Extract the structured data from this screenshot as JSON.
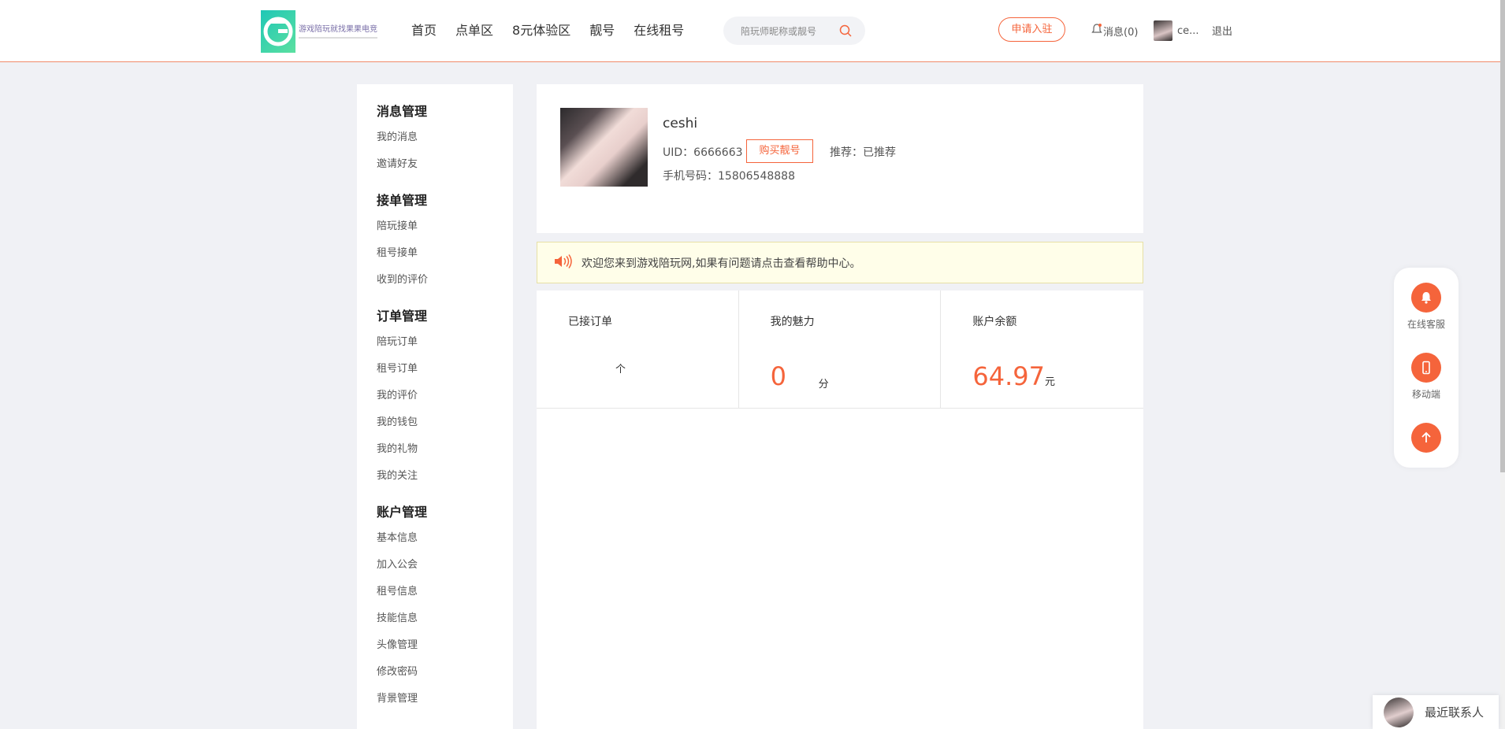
{
  "header": {
    "logo_text": "游戏陪玩就找果果电竞",
    "nav": [
      "首页",
      "点单区",
      "8元体验区",
      "靓号",
      "在线租号"
    ],
    "search_placeholder": "陪玩师昵称或靓号",
    "apply_label": "申请入驻",
    "messages_label": "消息(0)",
    "user_name": "ce...",
    "logout_label": "退出"
  },
  "sidebar": {
    "groups": [
      {
        "title": "消息管理",
        "items": [
          "我的消息",
          "邀请好友"
        ]
      },
      {
        "title": "接单管理",
        "items": [
          "陪玩接单",
          "租号接单",
          "收到的评价"
        ]
      },
      {
        "title": "订单管理",
        "items": [
          "陪玩订单",
          "租号订单",
          "我的评价",
          "我的钱包",
          "我的礼物",
          "我的关注"
        ]
      },
      {
        "title": "账户管理",
        "items": [
          "基本信息",
          "加入公会",
          "租号信息",
          "技能信息",
          "头像管理",
          "修改密码",
          "背景管理"
        ]
      }
    ]
  },
  "profile": {
    "name": "ceshi",
    "uid_text": "UID：6666663",
    "buy_label": "购买靓号",
    "recommend_text": "推荐：已推荐",
    "phone_text": "手机号码：15806548888"
  },
  "notice": {
    "text": "欢迎您来到游戏陪玩网,如果有问题请点击查看帮助中心。"
  },
  "stats": {
    "orders_label": "已接订单",
    "orders_value": "",
    "orders_unit": "个",
    "charm_label": "我的魅力",
    "charm_value": "0",
    "charm_unit": "分",
    "balance_label": "账户余额",
    "balance_value": "64.97",
    "balance_unit": "元"
  },
  "float_tools": {
    "service_label": "在线客服",
    "mobile_label": "移动端"
  },
  "recent_contacts": {
    "label": "最近联系人"
  },
  "colors": {
    "accent": "#f5643b",
    "notice_bg": "#fffee9",
    "page_bg": "#f0f1f5"
  }
}
